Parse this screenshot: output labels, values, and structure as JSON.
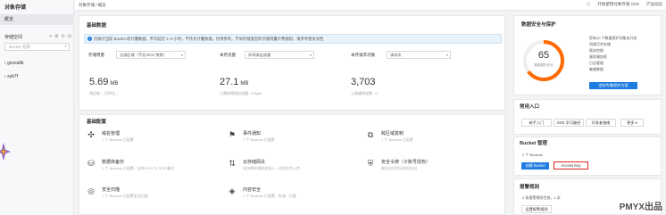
{
  "sidebar": {
    "title": "对象存储",
    "overview": "概览",
    "bucket_list_label": "存储空间",
    "search_placeholder": "Bucket 名称",
    "buckets": [
      "gcosa9k",
      "xyb7f"
    ]
  },
  "topbar": {
    "breadcrumb": "对象存储 / 概览",
    "links": [
      "开始使用对象存储 OSS",
      "产品动态"
    ]
  },
  "basic_data": {
    "title": "基础数据",
    "notice": "仅统计当前 Bucket 的计量数据，平均延迟 1~3 小时，不作为计量依据，仅供参考。不同存储类型的存储用量计费规则，请参考相关文档",
    "stats": [
      {
        "label": "存储用量",
        "select": "全部区域（不含 ECS 快照）",
        "value": "5.69",
        "unit": "MB",
        "sub": "同比较 -- 日环比 --"
      },
      {
        "label": "本月流量",
        "select": "外网流出流量",
        "value": "27.1",
        "unit": "MB",
        "sub": "上周外网流出流量 - 0 Byte"
      },
      {
        "label": "本月请求次数",
        "select": "请求次",
        "value": "3,703",
        "unit": "",
        "sub": "上周请求次数 - 0"
      }
    ]
  },
  "basic_config": {
    "title": "基础配置",
    "features": [
      {
        "icon": "domain-icon",
        "name": "域名管理",
        "desc": "1 个 Buckets 已配置"
      },
      {
        "icon": "event-icon",
        "name": "事件通知",
        "desc": "1 个 Buckets 已配置"
      },
      {
        "icon": "replication-icon",
        "name": "跨区域复制",
        "desc": "1 个 Buckets 已配置"
      },
      {
        "icon": "backup-icon",
        "name": "数据库备份",
        "desc": "1 个 Buckets 已配置，支持 ECS 与 RDS 备份"
      },
      {
        "icon": "gateway-icon",
        "name": "云存储网关",
        "desc": "支持将存储网关接入，本地文件上传"
      },
      {
        "icon": "shield-icon",
        "name": "安全令牌（子账号授权）",
        "desc": "临时访问凭证授权访问"
      },
      {
        "icon": "scan-icon",
        "name": "安全扫描",
        "desc": "1 个 Buckets 已配置安全扫描"
      },
      {
        "icon": "content-icon",
        "name": "内容安全",
        "desc": "1 个 Buckets 已配置，检测，扫描"
      }
    ]
  },
  "security": {
    "title": "数据安全与保护",
    "score": "65",
    "score_label": "数据保护评分",
    "items": [
      "您有10 个数据保护功能未开启",
      "同城冗余存储",
      "版本控制",
      "服务端加密",
      "日志管理",
      "敏感数据"
    ],
    "button": "定制专属保护方案",
    "accent": "#ff6a00"
  },
  "common_entry": {
    "title": "常用入口",
    "buttons": [
      "新手入门",
      "OSS 学习路径",
      "开发者指南",
      "更多"
    ]
  },
  "bucket_mgmt": {
    "title": "Bucket 管理",
    "count": "2 个 Buckets",
    "create_label": "创建 Bucket",
    "access_key_label": "Access Key"
  },
  "alarm": {
    "title": "报警规则",
    "text": "0 条报警规则生效，1 次",
    "button": "设置报警规则"
  },
  "watermark": "PMYX出品"
}
